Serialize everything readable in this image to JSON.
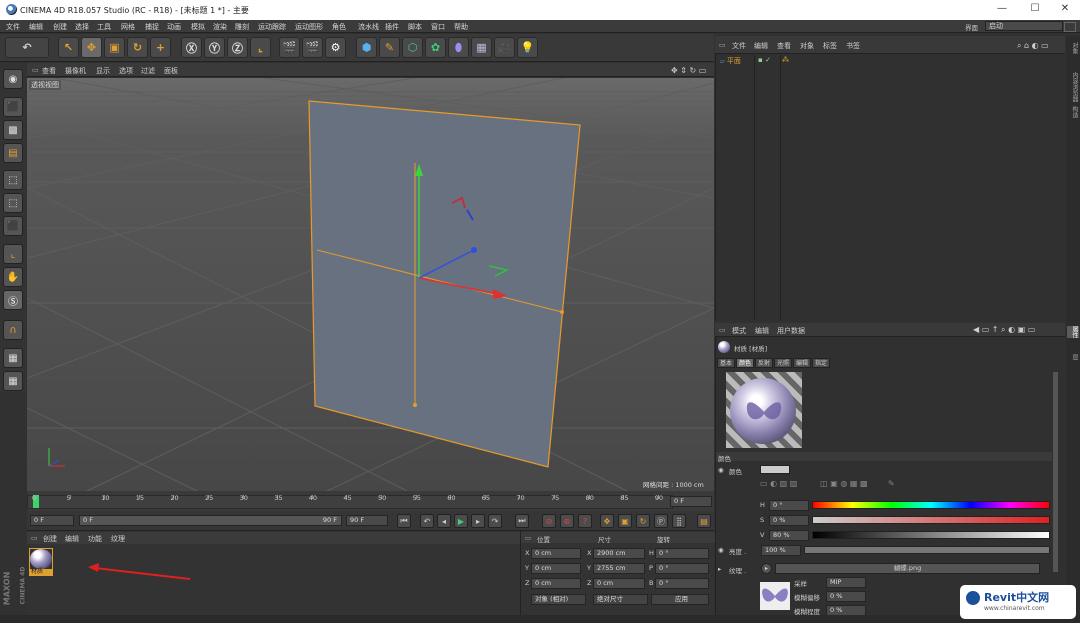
{
  "window": {
    "title": "CINEMA 4D R18.057 Studio (RC - R18) - [未标题 1 *] - 主要",
    "minimize": "—",
    "maximize": "☐",
    "close": "✕"
  },
  "menubar": {
    "items": [
      "文件",
      "编辑",
      "创建",
      "选择",
      "工具",
      "网格",
      "捕捉",
      "动画",
      "模拟",
      "渲染",
      "雕刻",
      "运动跟踪",
      "运动图形",
      "角色",
      "流水线",
      "插件",
      "脚本",
      "窗口",
      "帮助"
    ],
    "layout_label": "界面",
    "layout_value": "启动"
  },
  "viewport": {
    "menu": [
      "查看",
      "摄像机",
      "显示",
      "选项",
      "过滤",
      "面板"
    ],
    "view_name": "透视视图",
    "grid_spacing": "网格间距 : 1000 cm"
  },
  "timeline": {
    "ticks": [
      "0",
      "5",
      "10",
      "15",
      "20",
      "25",
      "30",
      "35",
      "40",
      "45",
      "50",
      "55",
      "60",
      "65",
      "70",
      "75",
      "80",
      "85",
      "90"
    ],
    "current_frame": "0 F"
  },
  "playbar": {
    "start": "0 F",
    "slider_start": "0 F",
    "slider_end": "90 F",
    "end": "90 F"
  },
  "material_manager": {
    "menu": [
      "创建",
      "编辑",
      "功能",
      "纹理"
    ],
    "material_name": "材质"
  },
  "coordinates": {
    "headers": [
      "位置",
      "尺寸",
      "旋转"
    ],
    "rows": [
      {
        "pos_axis": "X",
        "pos": "0 cm",
        "size_axis": "X",
        "size": "2900 cm",
        "rot_axis": "H",
        "rot": "0 °"
      },
      {
        "pos_axis": "Y",
        "pos": "0 cm",
        "size_axis": "Y",
        "size": "2755 cm",
        "rot_axis": "P",
        "rot": "0 °"
      },
      {
        "pos_axis": "Z",
        "pos": "0 cm",
        "size_axis": "Z",
        "size": "0 cm",
        "rot_axis": "B",
        "rot": "0 °"
      }
    ],
    "mode1": "对象 (相对)",
    "mode2": "绝对尺寸",
    "apply": "应用"
  },
  "object_manager": {
    "menu": [
      "文件",
      "编辑",
      "查看",
      "对象",
      "标签",
      "书签"
    ],
    "object_name": "平面"
  },
  "attribute_manager": {
    "menu": [
      "模式",
      "编辑",
      "用户数据"
    ],
    "title": "材质 [材质]",
    "tabs": [
      "基本",
      "颜色",
      "反射",
      "光照",
      "编辑",
      "指定"
    ],
    "section": "颜色",
    "color_label": "颜色",
    "hsv": [
      {
        "label": "H",
        "value": "0 °"
      },
      {
        "label": "S",
        "value": "0 %"
      },
      {
        "label": "V",
        "value": "80 %"
      }
    ],
    "brightness_label": "亮度 .",
    "brightness_value": "100 %",
    "texture_label": "纹理 .",
    "texture_file": "蝴蝶.png",
    "sampling_label": "采样",
    "sampling_value": "MIP",
    "blur_offset_label": "模糊偏移",
    "blur_offset_value": "0 %",
    "blur_scale_label": "模糊程度",
    "blur_scale_value": "0 %"
  },
  "right_tabs": [
    "对象",
    "内容浏览器",
    "构造",
    "属性",
    "层"
  ],
  "maxon": {
    "line1": "MAXON",
    "line2": "CINEMA 4D"
  },
  "watermark": {
    "brand": "Revit中文网",
    "url": "www.chinarevit.com"
  },
  "colors": {
    "accent": "#f0a020",
    "plane": "#67717f",
    "selection": "#e89a2b"
  }
}
